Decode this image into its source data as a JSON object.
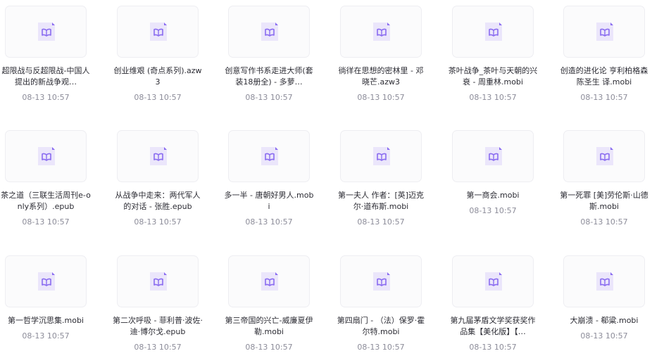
{
  "colors": {
    "icon_bg": "#ebe6fb",
    "icon_accent": "#8a6cf0",
    "text": "#2b2b33",
    "date": "#8c8c99"
  },
  "icon": "ebook-file-icon",
  "files": [
    {
      "name": "超限战与反超限战-中国人提出的新战争观…",
      "date": "08-13 10:57"
    },
    {
      "name": "创业维艰 (奇点系列).azw3",
      "date": "08-13 10:57"
    },
    {
      "name": "创意写作书系走进大师(套装18册全) - 多萝…",
      "date": "08-13 10:57"
    },
    {
      "name": "徜徉在思想的密林里 - 邓晓芒.azw3",
      "date": "08-13 10:57"
    },
    {
      "name": "茶叶战争_茶叶与天朝的兴衰 - 周重林.mobi",
      "date": "08-13 10:57"
    },
    {
      "name": "创造的进化论 亨利柏格森 陈圣生 译.mobi",
      "date": "08-13 10:57"
    },
    {
      "name": "茶之道（三联生活周刊e-only系列）.epub",
      "date": "08-13 10:57"
    },
    {
      "name": "从战争中走来：两代军人的对话 - 张胜.epub",
      "date": "08-13 10:57"
    },
    {
      "name": "多一半 - 唐朝好男人.mobi",
      "date": "08-13 10:57"
    },
    {
      "name": "第一夫人 作者：[英]迈克尔·道布斯.mobi",
      "date": "08-13 10:57"
    },
    {
      "name": "第一商会.mobi",
      "date": "08-13 10:57"
    },
    {
      "name": "第一死罪 [美]劳伦斯·山德斯.mobi",
      "date": "08-13 10:57"
    },
    {
      "name": "第一哲学沉思集.mobi",
      "date": "08-13 10:57"
    },
    {
      "name": "第二次呼吸 - 菲利普·波佐·迪·博尔戈.epub",
      "date": "08-13 10:57"
    },
    {
      "name": "第三帝国的兴亡-威廉夏伊勒.mobi",
      "date": "08-13 10:57"
    },
    {
      "name": "第四扇门 - （法）保罗·霍尔特.mobi",
      "date": "08-13 10:57"
    },
    {
      "name": "第九届茅盾文学奖获奖作品集【美化版】【…",
      "date": "08-13 10:57"
    },
    {
      "name": "大崩溃 - 郗粱.mobi",
      "date": "08-13 10:57"
    }
  ]
}
